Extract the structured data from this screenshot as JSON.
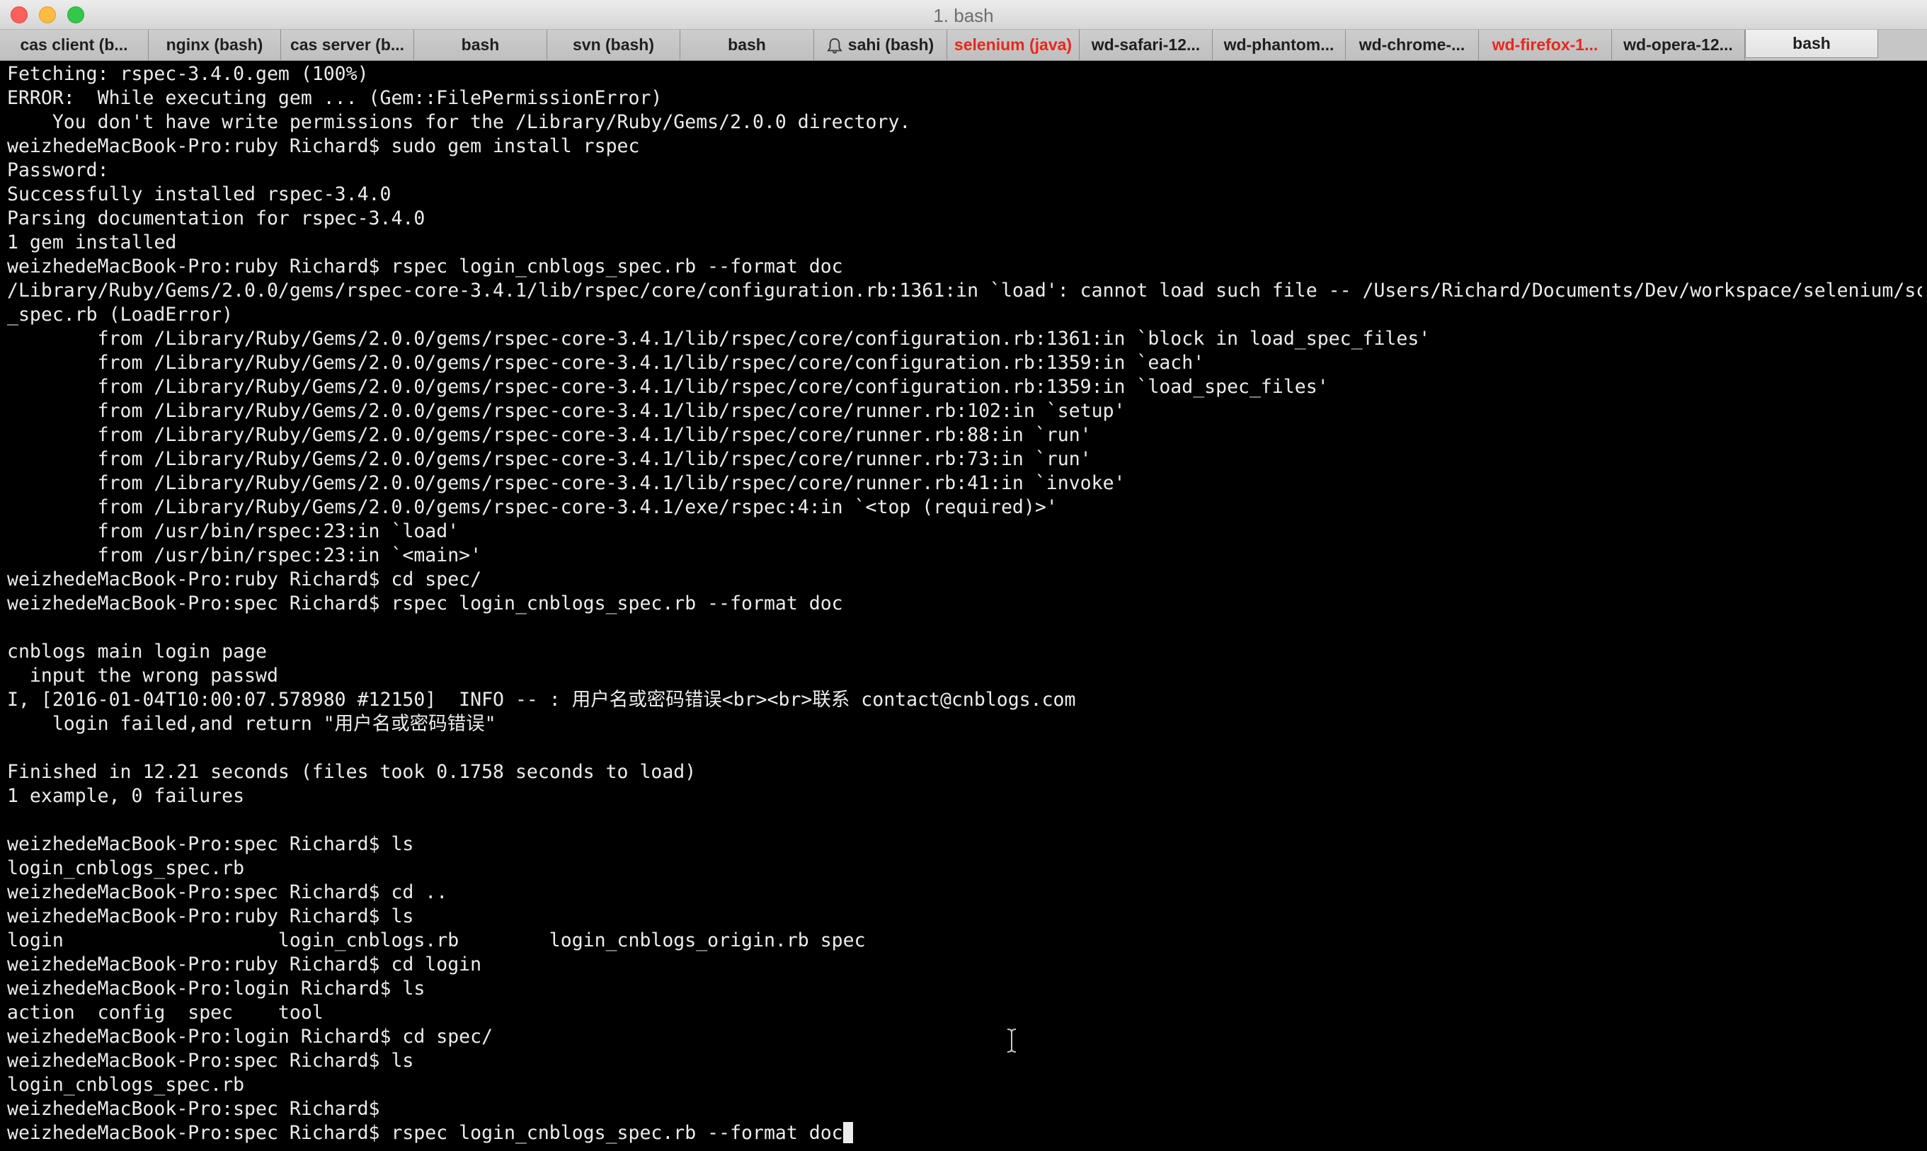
{
  "window": {
    "title": "1. bash"
  },
  "tabs": [
    {
      "label": "cas client (b...",
      "color": "#1f1f1f"
    },
    {
      "label": "nginx (bash)",
      "color": "#1f1f1f"
    },
    {
      "label": "cas server (b...",
      "color": "#1f1f1f"
    },
    {
      "label": "bash",
      "color": "#1f1f1f"
    },
    {
      "label": "svn (bash)",
      "color": "#1f1f1f"
    },
    {
      "label": "bash",
      "color": "#1f1f1f"
    },
    {
      "label": "sahi (bash)",
      "color": "#1f1f1f",
      "icon": "bell-icon"
    },
    {
      "label": "selenium (java)",
      "color": "#e8271d"
    },
    {
      "label": "wd-safari-12...",
      "color": "#1f1f1f"
    },
    {
      "label": "wd-phantom...",
      "color": "#1f1f1f"
    },
    {
      "label": "wd-chrome-...",
      "color": "#1f1f1f"
    },
    {
      "label": "wd-firefox-1...",
      "color": "#e8271d"
    },
    {
      "label": "wd-opera-12...",
      "color": "#1f1f1f"
    },
    {
      "label": "bash",
      "color": "#1f1f1f",
      "active": true
    }
  ],
  "terminal": {
    "lines": [
      "Fetching: rspec-3.4.0.gem (100%)",
      "ERROR:  While executing gem ... (Gem::FilePermissionError)",
      "    You don't have write permissions for the /Library/Ruby/Gems/2.0.0 directory.",
      "weizhedeMacBook-Pro:ruby Richard$ sudo gem install rspec",
      "Password:",
      "Successfully installed rspec-3.4.0",
      "Parsing documentation for rspec-3.4.0",
      "1 gem installed",
      "weizhedeMacBook-Pro:ruby Richard$ rspec login_cnblogs_spec.rb --format doc",
      "/Library/Ruby/Gems/2.0.0/gems/rspec-core-3.4.1/lib/rspec/core/configuration.rb:1361:in `load': cannot load such file -- /Users/Richard/Documents/Dev/workspace/selenium/script/ruby/login_cnblogs",
      "_spec.rb (LoadError)",
      "        from /Library/Ruby/Gems/2.0.0/gems/rspec-core-3.4.1/lib/rspec/core/configuration.rb:1361:in `block in load_spec_files'",
      "        from /Library/Ruby/Gems/2.0.0/gems/rspec-core-3.4.1/lib/rspec/core/configuration.rb:1359:in `each'",
      "        from /Library/Ruby/Gems/2.0.0/gems/rspec-core-3.4.1/lib/rspec/core/configuration.rb:1359:in `load_spec_files'",
      "        from /Library/Ruby/Gems/2.0.0/gems/rspec-core-3.4.1/lib/rspec/core/runner.rb:102:in `setup'",
      "        from /Library/Ruby/Gems/2.0.0/gems/rspec-core-3.4.1/lib/rspec/core/runner.rb:88:in `run'",
      "        from /Library/Ruby/Gems/2.0.0/gems/rspec-core-3.4.1/lib/rspec/core/runner.rb:73:in `run'",
      "        from /Library/Ruby/Gems/2.0.0/gems/rspec-core-3.4.1/lib/rspec/core/runner.rb:41:in `invoke'",
      "        from /Library/Ruby/Gems/2.0.0/gems/rspec-core-3.4.1/exe/rspec:4:in `<top (required)>'",
      "        from /usr/bin/rspec:23:in `load'",
      "        from /usr/bin/rspec:23:in `<main>'",
      "weizhedeMacBook-Pro:ruby Richard$ cd spec/",
      "weizhedeMacBook-Pro:spec Richard$ rspec login_cnblogs_spec.rb --format doc",
      "",
      "cnblogs main login page",
      "  input the wrong passwd",
      "I, [2016-01-04T10:00:07.578980 #12150]  INFO -- : 用户名或密码错误<br><br>联系 contact@cnblogs.com",
      "    login failed,and return \"用户名或密码错误\"",
      "",
      "Finished in 12.21 seconds (files took 0.1758 seconds to load)",
      "1 example, 0 failures",
      "",
      "weizhedeMacBook-Pro:spec Richard$ ls",
      "login_cnblogs_spec.rb",
      "weizhedeMacBook-Pro:spec Richard$ cd ..",
      "weizhedeMacBook-Pro:ruby Richard$ ls",
      "login                   login_cnblogs.rb        login_cnblogs_origin.rb spec",
      "weizhedeMacBook-Pro:ruby Richard$ cd login",
      "weizhedeMacBook-Pro:login Richard$ ls",
      "action  config  spec    tool",
      "weizhedeMacBook-Pro:login Richard$ cd spec/",
      "weizhedeMacBook-Pro:spec Richard$ ls",
      "login_cnblogs_spec.rb",
      "weizhedeMacBook-Pro:spec Richard$ ",
      "weizhedeMacBook-Pro:spec Richard$ rspec login_cnblogs_spec.rb --format doc"
    ]
  }
}
